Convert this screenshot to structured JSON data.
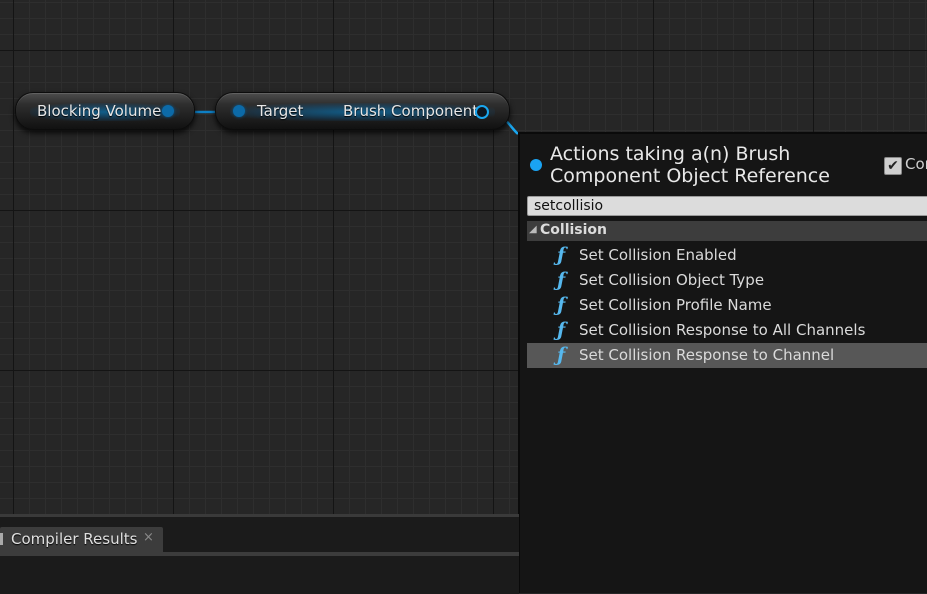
{
  "graph": {
    "nodes": {
      "blocking_volume": {
        "label": "Blocking Volume"
      },
      "get_brush": {
        "input_label": "Target",
        "output_label": "Brush Component"
      }
    }
  },
  "action_menu": {
    "title": "Actions taking a(n) Brush Component Object Reference",
    "context_checkbox": {
      "label": "Con",
      "checked": true
    },
    "search": {
      "value": "setcollisio"
    },
    "category": {
      "label": "Collision",
      "expanded": true
    },
    "items": [
      {
        "label": "Set Collision Enabled",
        "icon": "function-icon",
        "selected": false
      },
      {
        "label": "Set Collision Object Type",
        "icon": "function-icon",
        "selected": false
      },
      {
        "label": "Set Collision Profile Name",
        "icon": "function-icon",
        "selected": false
      },
      {
        "label": "Set Collision Response to All Channels",
        "icon": "function-icon",
        "selected": false
      },
      {
        "label": "Set Collision Response to Channel",
        "icon": "function-icon",
        "selected": true
      }
    ],
    "function_glyph": "ƒ"
  },
  "bottom_panel": {
    "tab": {
      "label": "Compiler Results",
      "close": "×"
    }
  },
  "colors": {
    "accent": "#1aa7f0",
    "graph_bg": "#262626",
    "menu_bg": "#151515",
    "selected_row": "#575757",
    "category_row": "#3d3d3d"
  }
}
